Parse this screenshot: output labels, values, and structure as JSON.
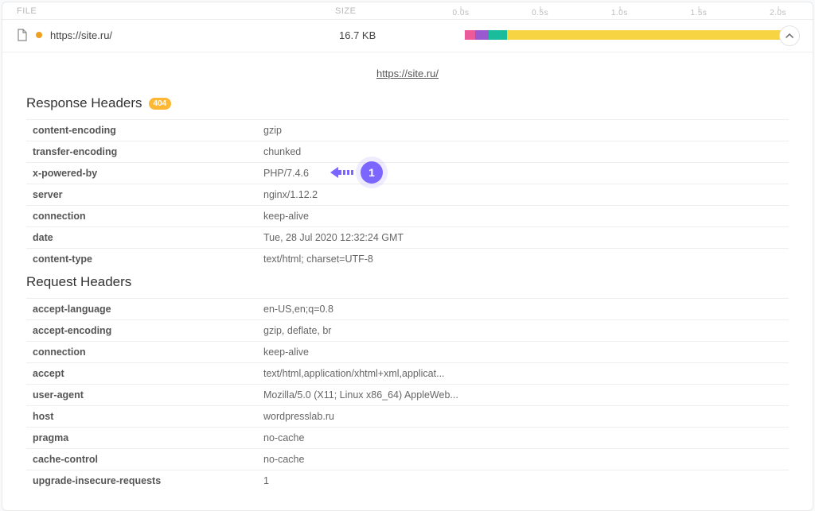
{
  "header": {
    "col_file": "FILE",
    "col_size": "SIZE",
    "ticks": [
      "0.0s",
      "0.5s",
      "1.0s",
      "1.5s",
      "2.0s"
    ]
  },
  "file": {
    "url": "https://site.ru/",
    "size": "16.7 KB",
    "bars": [
      {
        "left": 0,
        "width": 3.2,
        "color": "#ed5a9b"
      },
      {
        "left": 3.2,
        "width": 4.0,
        "color": "#9b59d0"
      },
      {
        "left": 7.2,
        "width": 5.5,
        "color": "#1abc9c"
      },
      {
        "left": 12.7,
        "width": 82,
        "color": "#f7d442"
      }
    ]
  },
  "detail_url": "https://site.ru/",
  "response_title": "Response Headers",
  "status_badge": "404",
  "response_headers": [
    {
      "k": "content-encoding",
      "v": "gzip"
    },
    {
      "k": "transfer-encoding",
      "v": "chunked"
    },
    {
      "k": "x-powered-by",
      "v": "PHP/7.4.6"
    },
    {
      "k": "server",
      "v": "nginx/1.12.2"
    },
    {
      "k": "connection",
      "v": "keep-alive"
    },
    {
      "k": "date",
      "v": "Tue, 28 Jul 2020 12:32:24 GMT"
    },
    {
      "k": "content-type",
      "v": "text/html; charset=UTF-8"
    }
  ],
  "request_title": "Request Headers",
  "request_headers": [
    {
      "k": "accept-language",
      "v": "en-US,en;q=0.8"
    },
    {
      "k": "accept-encoding",
      "v": "gzip, deflate, br"
    },
    {
      "k": "connection",
      "v": "keep-alive"
    },
    {
      "k": "accept",
      "v": "text/html,application/xhtml+xml,applicat..."
    },
    {
      "k": "user-agent",
      "v": "Mozilla/5.0 (X11; Linux x86_64) AppleWeb..."
    },
    {
      "k": "host",
      "v": "wordpresslab.ru"
    },
    {
      "k": "pragma",
      "v": "no-cache"
    },
    {
      "k": "cache-control",
      "v": "no-cache"
    },
    {
      "k": "upgrade-insecure-requests",
      "v": "1"
    }
  ],
  "annotation": {
    "number": "1"
  }
}
